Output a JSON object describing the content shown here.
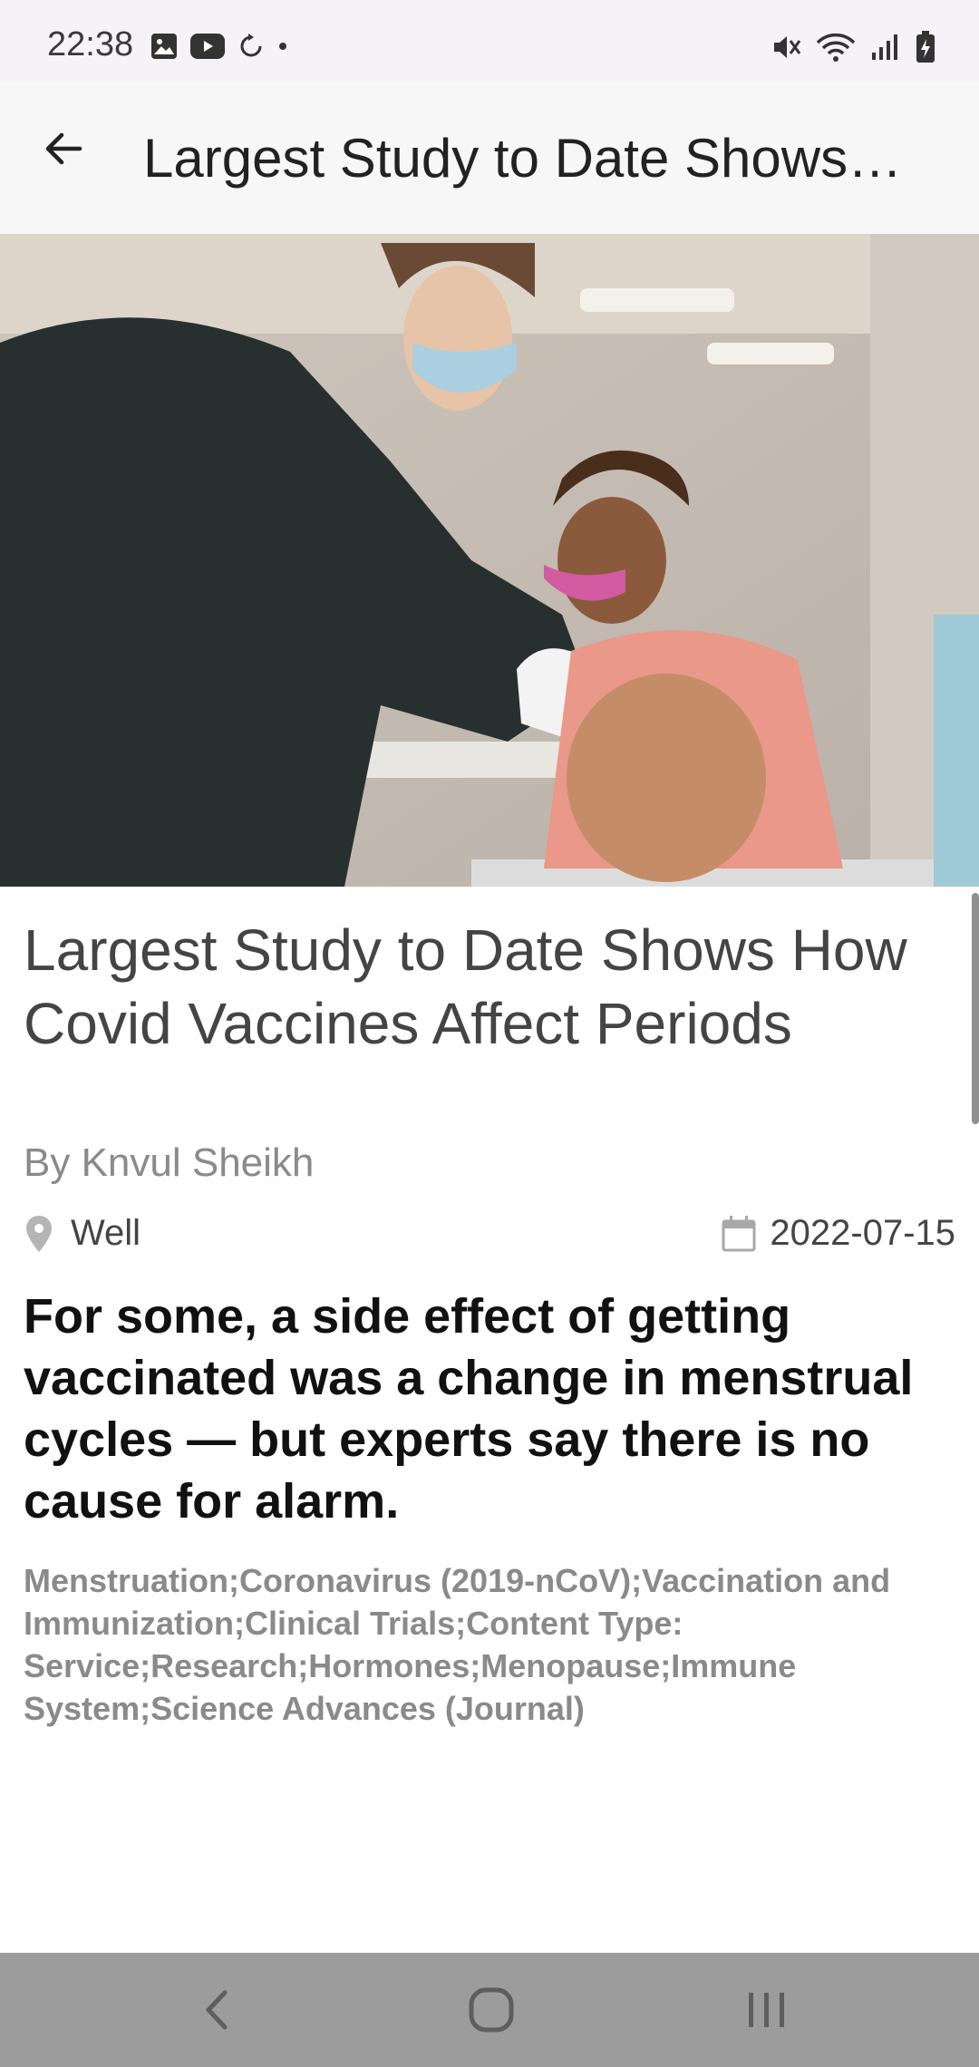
{
  "status_bar": {
    "time": "22:38",
    "left_icons": [
      "gallery-icon",
      "youtube-icon",
      "sync-icon",
      "dot-icon"
    ],
    "right_icons": [
      "mute-icon",
      "wifi-icon",
      "signal-icon",
      "battery-icon"
    ]
  },
  "app_bar": {
    "back_icon": "arrow-back-icon",
    "title": "Largest Study to Date Shows…"
  },
  "article": {
    "title": "Largest Study to Date Shows How Covid Vaccines Affect Periods",
    "byline": "By Knvul Sheikh",
    "section": "Well",
    "section_icon": "location-pin-icon",
    "date": "2022-07-15",
    "date_icon": "calendar-icon",
    "summary": "For some, a side effect of getting vaccinated was a change in menstrual cycles — but experts say there is no cause for alarm.",
    "keywords": "Menstruation;Coronavirus (2019-nCoV);Vaccination and Immunization;Clinical Trials;Content Type: Service;Research;Hormones;Menopause;Immune System;Science Advances (Journal)"
  },
  "nav_bar": {
    "buttons": [
      "back-nav-icon",
      "home-nav-icon",
      "recents-nav-icon"
    ]
  },
  "colors": {
    "app_bar_bg": "#f7f7f7",
    "status_bar_bg": "#f6f3f8",
    "nav_bar_bg": "#9c9c9c",
    "title_text": "#444447",
    "muted_text": "#8a8a8a"
  }
}
